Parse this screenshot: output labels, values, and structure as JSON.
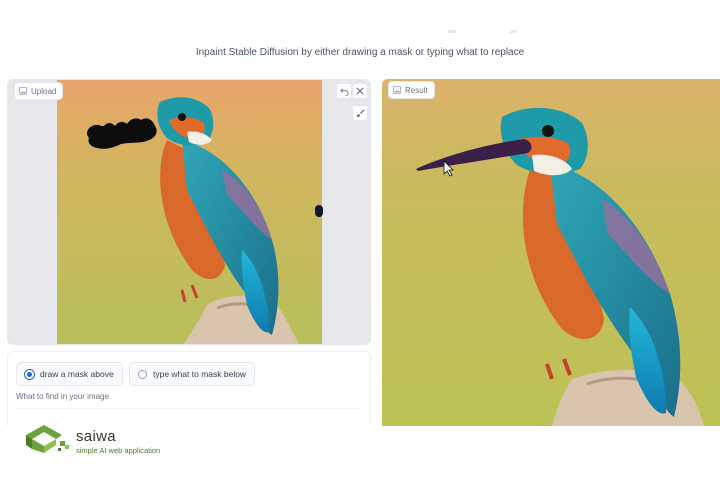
{
  "header": {
    "subtitle": "Inpaint Stable Diffusion by either drawing a mask or typing what to replace"
  },
  "upload": {
    "label": "Upload",
    "label_icon": "image-icon",
    "tools": [
      "undo-icon",
      "close-icon",
      "brush-icon"
    ]
  },
  "result": {
    "label": "Result",
    "label_icon": "image-icon"
  },
  "mask_options": {
    "selected": "draw a mask above",
    "options": [
      "draw a mask above",
      "type what to mask below"
    ]
  },
  "prompt_field": {
    "label": "What to find in your image",
    "value": ""
  },
  "watermark": {
    "name": "saiwa",
    "tagline": "simple AI web application"
  },
  "colors": {
    "accent": "#2563eb",
    "panel_bg": "#e5e7eb",
    "logo_green": "#6aa33b",
    "logo_dark": "#2f3a2a"
  }
}
